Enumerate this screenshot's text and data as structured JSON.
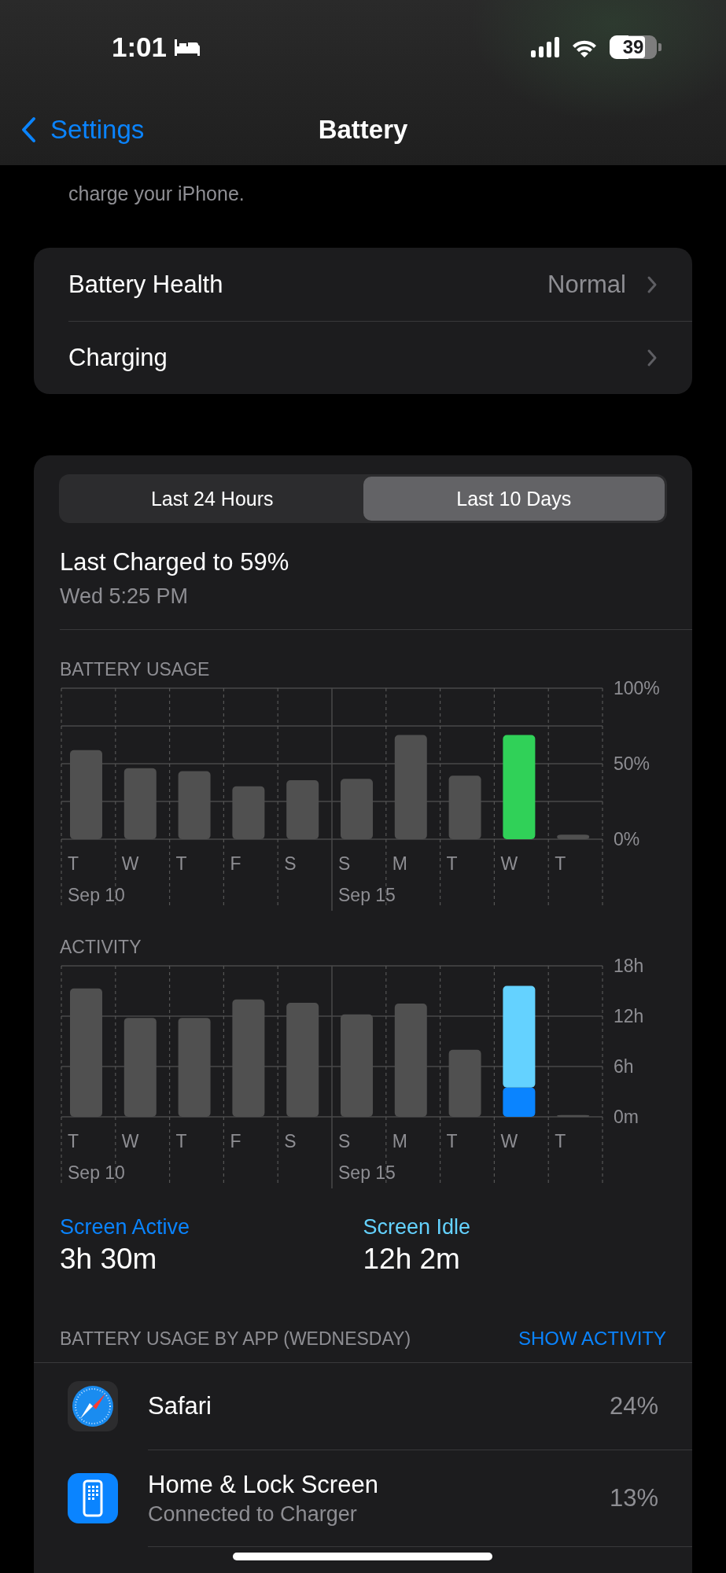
{
  "status_bar": {
    "time": "1:01",
    "battery": "39"
  },
  "nav": {
    "back": "Settings",
    "title": "Battery"
  },
  "description": "charge your iPhone.",
  "settings_rows": [
    {
      "label": "Battery Health",
      "value": "Normal"
    },
    {
      "label": "Charging"
    }
  ],
  "tabs": [
    {
      "label": "Last 24 Hours",
      "selected": false
    },
    {
      "label": "Last 10 Days",
      "selected": true
    }
  ],
  "last_charged": {
    "title": "Last Charged to 59%",
    "time": "Wed 5:25 PM"
  },
  "battery_usage": {
    "title": "BATTERY USAGE",
    "date_labels": [
      "Sep 10",
      "Sep 15"
    ],
    "chart_data": {
      "type": "bar",
      "categories": [
        "T",
        "W",
        "T",
        "F",
        "S",
        "S",
        "M",
        "T",
        "W",
        "T"
      ],
      "stacked": true,
      "ylim": [
        0,
        100
      ],
      "yticks": [
        {
          "value": 0,
          "label": "0%"
        },
        {
          "value": 50,
          "label": "50%"
        },
        {
          "value": 100,
          "label": "100%"
        }
      ],
      "series": [
        {
          "color": "#505050",
          "values": [
            59,
            47,
            45,
            35,
            39,
            40,
            69,
            42,
            null,
            3
          ]
        },
        {
          "color": "#30d158",
          "values": [
            null,
            null,
            null,
            null,
            null,
            null,
            null,
            null,
            69,
            null
          ]
        }
      ]
    }
  },
  "activity": {
    "title": "ACTIVITY",
    "date_labels": [
      "Sep 10",
      "Sep 15"
    ],
    "chart_data": {
      "type": "bar",
      "categories": [
        "T",
        "W",
        "T",
        "F",
        "S",
        "S",
        "M",
        "T",
        "W",
        "T"
      ],
      "stacked": true,
      "ylim": [
        0,
        18
      ],
      "yticks": [
        {
          "value": 0,
          "label": "0m"
        },
        {
          "value": 6,
          "label": "6h"
        },
        {
          "value": 12,
          "label": "12h"
        },
        {
          "value": 18,
          "label": "18h"
        }
      ],
      "series": [
        {
          "color": "#505050",
          "values": [
            15.3,
            11.8,
            11.8,
            14,
            13.6,
            12.2,
            13.5,
            8,
            null,
            0.2
          ]
        },
        {
          "color": "#0a84ff",
          "values": [
            null,
            null,
            null,
            null,
            null,
            null,
            null,
            null,
            3.5,
            null
          ]
        },
        {
          "color": "#64d2ff",
          "values": [
            null,
            null,
            null,
            null,
            null,
            null,
            null,
            null,
            12.1,
            null
          ]
        }
      ]
    }
  },
  "screen_time": [
    {
      "label": "Screen Active",
      "value": "3h 30m",
      "color": "#0a84ff"
    },
    {
      "label": "Screen Idle",
      "value": "12h 2m",
      "color": "#64d2ff"
    }
  ],
  "apps_section": {
    "title": "BATTERY USAGE BY APP (WEDNESDAY)",
    "action": "SHOW ACTIVITY"
  },
  "apps": [
    {
      "kind": "safari",
      "name": "Safari",
      "percent": "24%"
    },
    {
      "kind": "home",
      "name": "Home & Lock Screen",
      "detail": "Connected to Charger",
      "percent": "13%"
    }
  ]
}
